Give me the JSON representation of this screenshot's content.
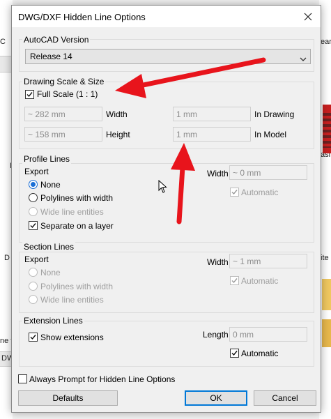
{
  "background": {
    "left_texts": [
      "C",
      "I",
      "D",
      "ne f",
      "DW"
    ],
    "right_texts": [
      "ear",
      "asi",
      "ite"
    ]
  },
  "dialog": {
    "title": "DWG/DXF Hidden Line Options",
    "autocad_version": {
      "group_label": "AutoCAD Version",
      "selected": "Release 14"
    },
    "drawing_scale": {
      "group_label": "Drawing Scale & Size",
      "full_scale_label": "Full Scale (1 : 1)",
      "full_scale_checked": true,
      "width_value": "~ 282 mm",
      "width_label": "Width",
      "height_value": "~ 158 mm",
      "height_label": "Height",
      "in_drawing_value": "1 mm",
      "in_drawing_label": "In Drawing",
      "in_model_value": "1 mm",
      "in_model_label": "In Model"
    },
    "profile_lines": {
      "group_label": "Profile Lines",
      "export_label": "Export",
      "options": [
        "None",
        "Polylines with width",
        "Wide line entities"
      ],
      "selected": "None",
      "separate_layer_label": "Separate on a layer",
      "separate_layer_checked": true,
      "width_label": "Width",
      "width_value": "~ 0 mm",
      "automatic_label": "Automatic",
      "automatic_checked": true
    },
    "section_lines": {
      "group_label": "Section Lines",
      "export_label": "Export",
      "options": [
        "None",
        "Polylines with width",
        "Wide line entities"
      ],
      "width_label": "Width",
      "width_value": "~ 1 mm",
      "automatic_label": "Automatic",
      "automatic_checked": true
    },
    "extension_lines": {
      "group_label": "Extension Lines",
      "show_extensions_label": "Show extensions",
      "show_extensions_checked": true,
      "length_label": "Length",
      "length_value": "0 mm",
      "automatic_label": "Automatic",
      "automatic_checked": true
    },
    "always_prompt_label": "Always Prompt for Hidden Line Options",
    "always_prompt_checked": false,
    "buttons": {
      "defaults": "Defaults",
      "ok": "OK",
      "cancel": "Cancel"
    }
  },
  "colors": {
    "accent": "#1a6fd6",
    "arrow": "#e8141c",
    "default_button_border": "#0078d7"
  },
  "icons": [
    "close-icon",
    "chevron-down-icon",
    "checkmark-icon",
    "mouse-cursor-icon",
    "red-arrow-annotation"
  ]
}
